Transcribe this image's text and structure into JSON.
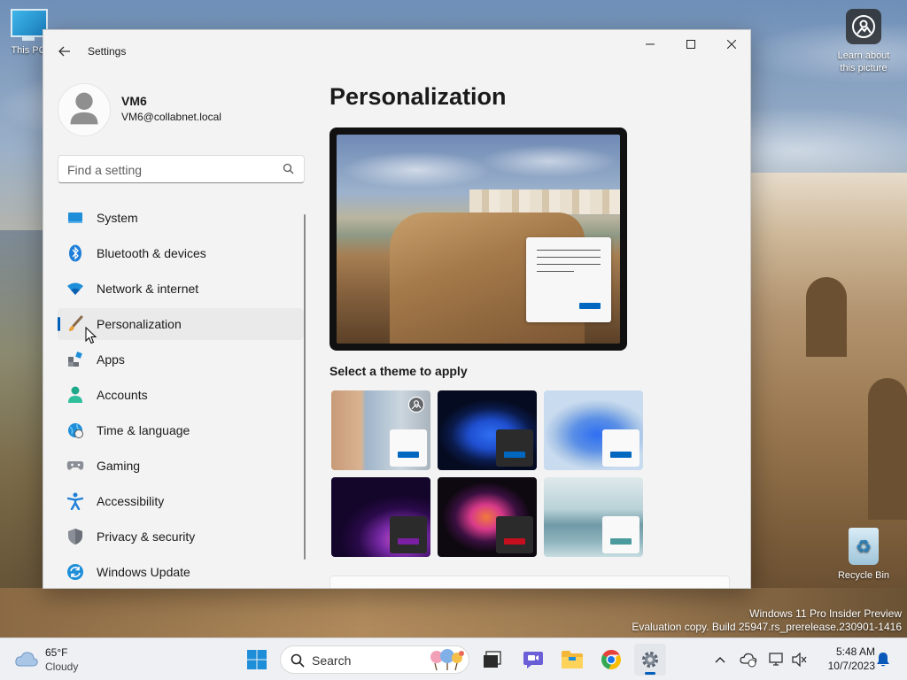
{
  "desktop": {
    "this_pc_label": "This PC",
    "learn_label": "Learn about this picture",
    "recycle_label": "Recycle Bin",
    "watermark_line1": "Windows 11 Pro Insider Preview",
    "watermark_line2": "Evaluation copy. Build 25947.rs_prerelease.230901-1416"
  },
  "window": {
    "title": "Settings",
    "user": {
      "name": "VM6",
      "email": "VM6@collabnet.local"
    },
    "search": {
      "placeholder": "Find a setting"
    },
    "nav": [
      {
        "label": "System",
        "icon": "monitor-icon"
      },
      {
        "label": "Bluetooth & devices",
        "icon": "bluetooth-icon"
      },
      {
        "label": "Network & internet",
        "icon": "wifi-icon"
      },
      {
        "label": "Personalization",
        "icon": "paintbrush-icon",
        "active": true
      },
      {
        "label": "Apps",
        "icon": "apps-icon"
      },
      {
        "label": "Accounts",
        "icon": "person-icon"
      },
      {
        "label": "Time & language",
        "icon": "globe-clock-icon"
      },
      {
        "label": "Gaming",
        "icon": "gamepad-icon"
      },
      {
        "label": "Accessibility",
        "icon": "accessibility-icon"
      },
      {
        "label": "Privacy & security",
        "icon": "shield-icon"
      },
      {
        "label": "Windows Update",
        "icon": "update-icon"
      }
    ],
    "page_title": "Personalization",
    "theme_label": "Select a theme to apply",
    "themes": [
      {
        "name": "theme-1",
        "accent": "#0067c0"
      },
      {
        "name": "theme-2",
        "accent": "#0067c0"
      },
      {
        "name": "theme-3",
        "accent": "#0067c0"
      },
      {
        "name": "theme-4",
        "accent": "#7a1fa2"
      },
      {
        "name": "theme-5",
        "accent": "#c50f1f"
      },
      {
        "name": "theme-6",
        "accent": "#4a9a9e"
      }
    ]
  },
  "taskbar": {
    "weather_temp": "65°F",
    "weather_cond": "Cloudy",
    "search_label": "Search",
    "time": "5:48 AM",
    "date": "10/7/2023"
  },
  "colors": {
    "accent": "#005fb8"
  }
}
